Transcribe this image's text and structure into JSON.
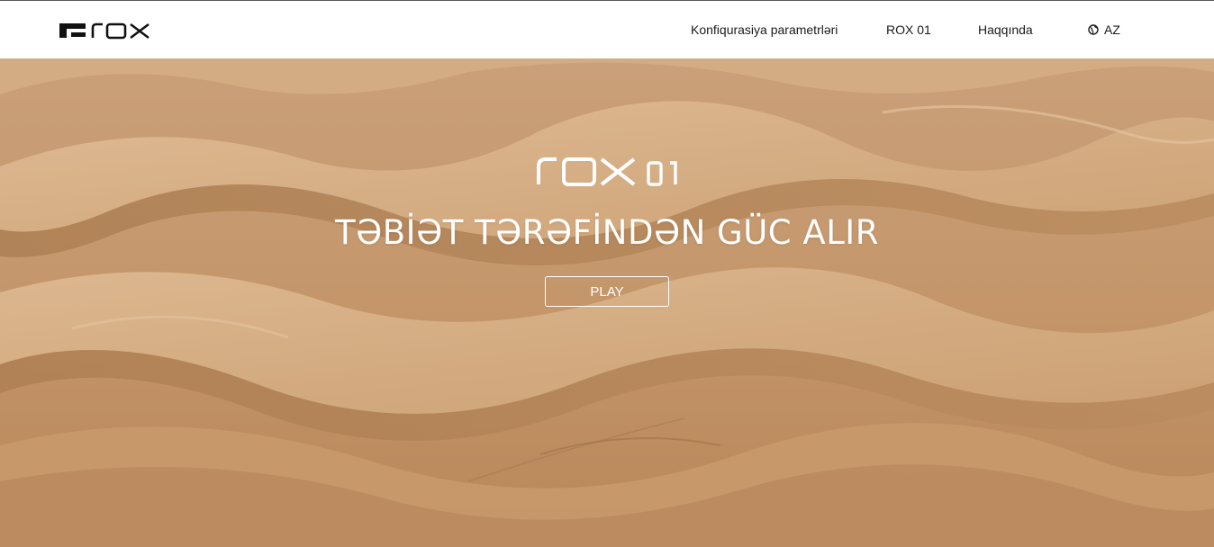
{
  "header": {
    "logo_text": "rox",
    "nav": [
      {
        "label": "Konfiqurasiya parametrləri"
      },
      {
        "label": "ROX 01"
      },
      {
        "label": "Haqqında"
      }
    ],
    "language": {
      "label": "AZ",
      "icon": "globe-icon"
    }
  },
  "hero": {
    "logo_text": "rox 01",
    "title": "TƏBİƏT TƏRƏFİNDƏN GÜC ALIR",
    "play_label": "PLAY",
    "background": "desert-dunes-image"
  },
  "colors": {
    "header_bg": "#ffffff",
    "nav_text": "#1a1a1a",
    "hero_text": "#ffffff",
    "sand_light": "#d8b086",
    "sand_mid": "#c49566",
    "sand_dark": "#9c6f45"
  }
}
